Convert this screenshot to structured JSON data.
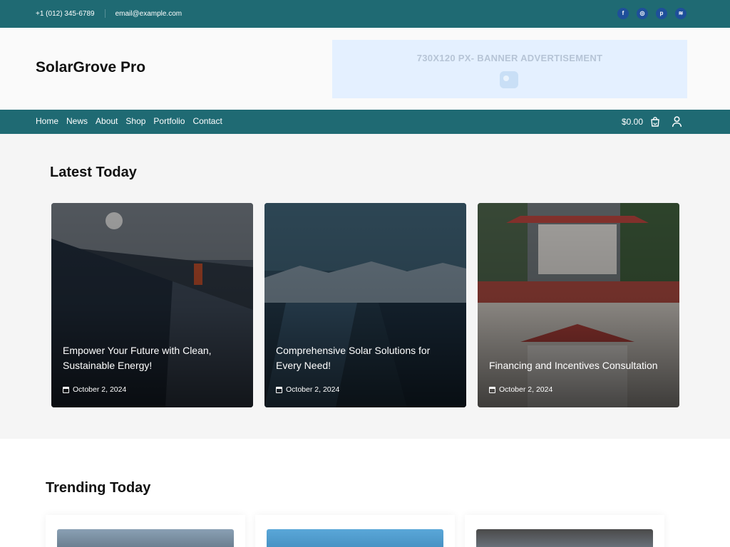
{
  "topbar": {
    "phone": "+1 (012) 345-6789",
    "email": "email@example.com",
    "social": [
      {
        "icon": "facebook-icon",
        "glyph": "f"
      },
      {
        "icon": "instagram-icon",
        "glyph": "◎"
      },
      {
        "icon": "pinterest-icon",
        "glyph": "p"
      },
      {
        "icon": "spotify-icon",
        "glyph": "≋"
      }
    ]
  },
  "header": {
    "site_title": "SolarGrove Pro",
    "banner_text": "730X120 PX- BANNER ADVERTISEMENT"
  },
  "nav": {
    "items": [
      "Home",
      "News",
      "About",
      "Shop",
      "Portfolio",
      "Contact"
    ],
    "cart_total": "$0.00"
  },
  "latest": {
    "heading": "Latest Today",
    "posts": [
      {
        "title": "Empower Your Future with Clean, Sustainable Energy!",
        "date": "October 2, 2024"
      },
      {
        "title": "Comprehensive Solar Solutions for Every Need!",
        "date": "October 2, 2024"
      },
      {
        "title": "Financing and Incentives Consultation",
        "date": "October 2, 2024"
      }
    ]
  },
  "trending": {
    "heading": "Trending Today"
  },
  "colors": {
    "brand_teal": "#1f6a73",
    "social_blue": "#1e4f9a",
    "banner_bg": "#e4f0ff"
  }
}
